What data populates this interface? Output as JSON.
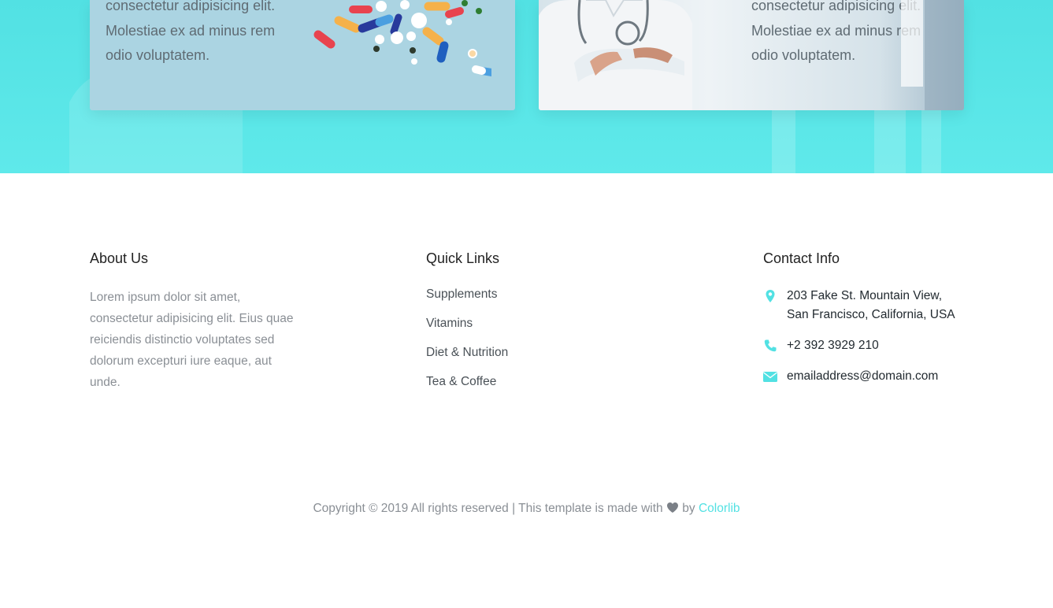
{
  "cards": {
    "left": {
      "lines": [
        "consectetur adipisicing elit.",
        "Molestiae ex ad minus rem",
        "odio voluptatem."
      ]
    },
    "right": {
      "lines": [
        "consectetur adipisicing elit.",
        "Molestiae ex ad minus rem",
        "odio voluptatem."
      ]
    }
  },
  "footer": {
    "about": {
      "title": "About Us",
      "text": "Lorem ipsum dolor sit amet, consectetur adipisicing elit. Eius quae reiciendis distinctio voluptates sed dolorum excepturi iure eaque, aut unde."
    },
    "links": {
      "title": "Quick Links",
      "items": [
        "Supplements",
        "Vitamins",
        "Diet & Nutrition",
        "Tea & Coffee"
      ]
    },
    "contact": {
      "title": "Contact Info",
      "address_line1": "203 Fake St. Mountain View,",
      "address_line2": "San Francisco, California, USA",
      "phone": "+2 392 3929 210",
      "email": "emailaddress@domain.com",
      "icons": [
        "map-marker-icon",
        "phone-icon",
        "envelope-icon"
      ]
    }
  },
  "copyright": {
    "prefix": "Copyright © 2019 All rights reserved",
    "separator": "|",
    "made_with": "This template is made with",
    "by": "by",
    "link": "Colorlib"
  },
  "colors": {
    "accent": "#52e1e3",
    "heading": "#222222",
    "muted": "#8a8f95"
  }
}
